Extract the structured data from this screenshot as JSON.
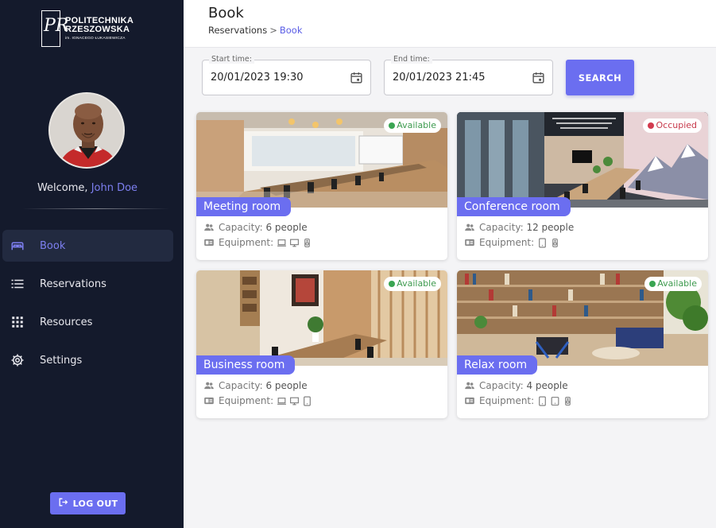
{
  "brand": {
    "line1": "POLITECHNIKA",
    "line2": "RZESZOWSKA",
    "line3": "im. IGNACEGO ŁUKASIEWICZA"
  },
  "user": {
    "welcome": "Welcome,",
    "name": "John Doe"
  },
  "nav": [
    {
      "label": "Book",
      "icon": "bed-icon",
      "active": true
    },
    {
      "label": "Reservations",
      "icon": "list-icon",
      "active": false
    },
    {
      "label": "Resources",
      "icon": "grid-icon",
      "active": false
    },
    {
      "label": "Settings",
      "icon": "gear-icon",
      "active": false
    }
  ],
  "logout_label": "LOG OUT",
  "header": {
    "title": "Book",
    "breadcrumb_parent": "Reservations",
    "breadcrumb_sep": ">",
    "breadcrumb_current": "Book"
  },
  "search": {
    "start_label": "Start time:",
    "start_value": "20/01/2023 19:30",
    "end_label": "End time:",
    "end_value": "20/01/2023 21:45",
    "button": "SEARCH"
  },
  "rooms": [
    {
      "name": "Meeting room",
      "status": "Available",
      "capacity_label": "Capacity:",
      "capacity": "6 people",
      "equipment_label": "Equipment:",
      "equipment": [
        "laptop-icon",
        "monitor-icon",
        "speaker-icon"
      ]
    },
    {
      "name": "Conference room",
      "status": "Occupied",
      "capacity_label": "Capacity:",
      "capacity": "12 people",
      "equipment_label": "Equipment:",
      "equipment": [
        "tablet-icon",
        "speaker-icon"
      ]
    },
    {
      "name": "Business room",
      "status": "Available",
      "capacity_label": "Capacity:",
      "capacity": "6 people",
      "equipment_label": "Equipment:",
      "equipment": [
        "laptop-icon",
        "monitor-icon",
        "tablet-icon"
      ]
    },
    {
      "name": "Relax room",
      "status": "Available",
      "capacity_label": "Capacity:",
      "capacity": "4 people",
      "equipment_label": "Equipment:",
      "equipment": [
        "tablet-icon",
        "tablet-icon",
        "speaker-icon"
      ]
    }
  ],
  "colors": {
    "accent": "#6b6ef0",
    "sidebar": "#141a2c",
    "available": "#3aa552",
    "occupied": "#d23a4e"
  }
}
